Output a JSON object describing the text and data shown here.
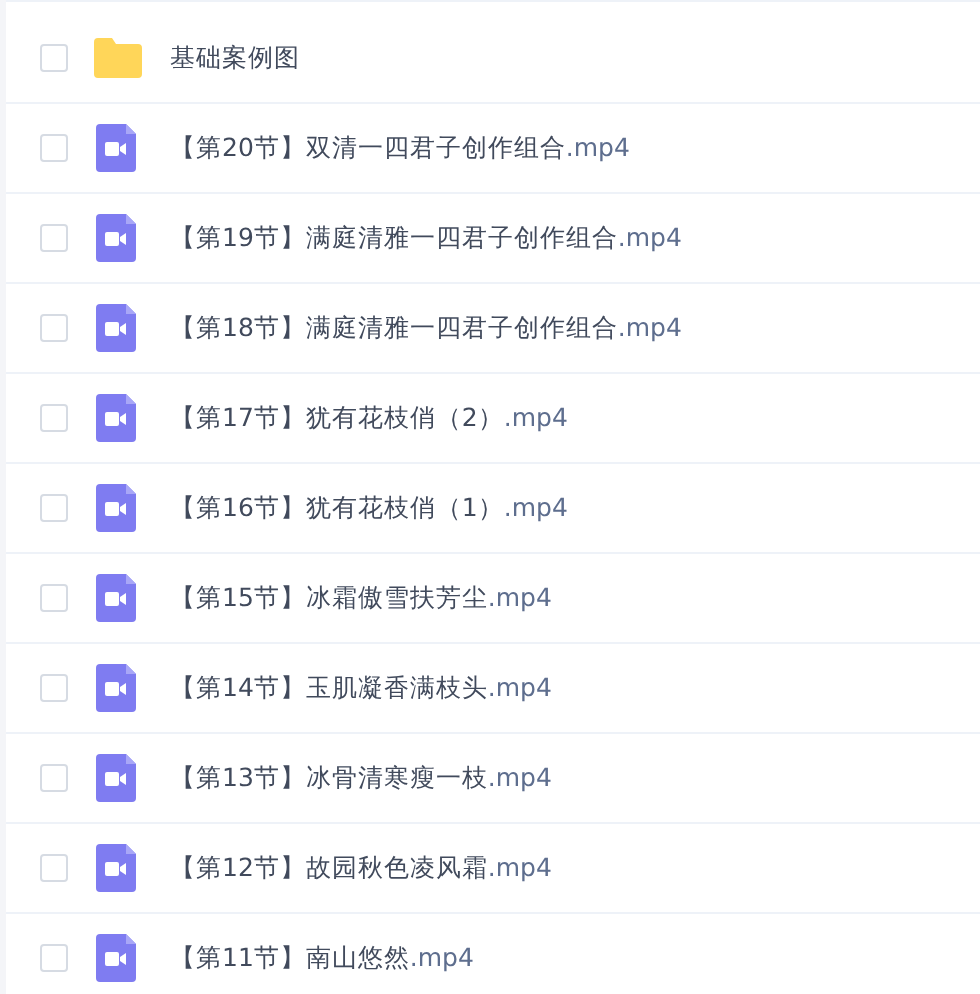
{
  "files": [
    {
      "kind": "folder",
      "name": "基础案例图",
      "checked": false
    },
    {
      "kind": "video",
      "name": "【第20节】双清一四君子创作组合",
      "extension": ".mp4",
      "checked": false
    },
    {
      "kind": "video",
      "name": "【第19节】满庭清雅一四君子创作组合",
      "extension": ".mp4",
      "checked": false
    },
    {
      "kind": "video",
      "name": "【第18节】满庭清雅一四君子创作组合",
      "extension": ".mp4",
      "checked": false
    },
    {
      "kind": "video",
      "name": "【第17节】犹有花枝俏（2）",
      "extension": ".mp4",
      "checked": false
    },
    {
      "kind": "video",
      "name": "【第16节】犹有花枝俏（1）",
      "extension": ".mp4",
      "checked": false
    },
    {
      "kind": "video",
      "name": "【第15节】冰霜傲雪扶芳尘",
      "extension": ".mp4",
      "checked": false
    },
    {
      "kind": "video",
      "name": "【第14节】玉肌凝香满枝头",
      "extension": ".mp4",
      "checked": false
    },
    {
      "kind": "video",
      "name": "【第13节】冰骨清寒瘦一枝",
      "extension": ".mp4",
      "checked": false
    },
    {
      "kind": "video",
      "name": "【第12节】故园秋色凌风霜",
      "extension": ".mp4",
      "checked": false
    },
    {
      "kind": "video",
      "name": "【第11节】南山悠然",
      "extension": ".mp4",
      "checked": false
    }
  ]
}
